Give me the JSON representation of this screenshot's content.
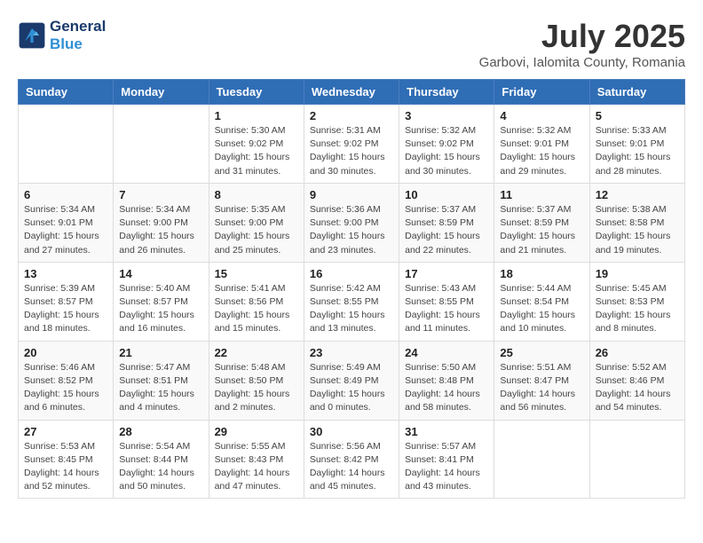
{
  "header": {
    "logo_line1": "General",
    "logo_line2": "Blue",
    "month": "July 2025",
    "location": "Garbovi, Ialomita County, Romania"
  },
  "weekdays": [
    "Sunday",
    "Monday",
    "Tuesday",
    "Wednesday",
    "Thursday",
    "Friday",
    "Saturday"
  ],
  "weeks": [
    [
      {
        "day": null,
        "info": null
      },
      {
        "day": null,
        "info": null
      },
      {
        "day": "1",
        "info": "Sunrise: 5:30 AM\nSunset: 9:02 PM\nDaylight: 15 hours and 31 minutes."
      },
      {
        "day": "2",
        "info": "Sunrise: 5:31 AM\nSunset: 9:02 PM\nDaylight: 15 hours and 30 minutes."
      },
      {
        "day": "3",
        "info": "Sunrise: 5:32 AM\nSunset: 9:02 PM\nDaylight: 15 hours and 30 minutes."
      },
      {
        "day": "4",
        "info": "Sunrise: 5:32 AM\nSunset: 9:01 PM\nDaylight: 15 hours and 29 minutes."
      },
      {
        "day": "5",
        "info": "Sunrise: 5:33 AM\nSunset: 9:01 PM\nDaylight: 15 hours and 28 minutes."
      }
    ],
    [
      {
        "day": "6",
        "info": "Sunrise: 5:34 AM\nSunset: 9:01 PM\nDaylight: 15 hours and 27 minutes."
      },
      {
        "day": "7",
        "info": "Sunrise: 5:34 AM\nSunset: 9:00 PM\nDaylight: 15 hours and 26 minutes."
      },
      {
        "day": "8",
        "info": "Sunrise: 5:35 AM\nSunset: 9:00 PM\nDaylight: 15 hours and 25 minutes."
      },
      {
        "day": "9",
        "info": "Sunrise: 5:36 AM\nSunset: 9:00 PM\nDaylight: 15 hours and 23 minutes."
      },
      {
        "day": "10",
        "info": "Sunrise: 5:37 AM\nSunset: 8:59 PM\nDaylight: 15 hours and 22 minutes."
      },
      {
        "day": "11",
        "info": "Sunrise: 5:37 AM\nSunset: 8:59 PM\nDaylight: 15 hours and 21 minutes."
      },
      {
        "day": "12",
        "info": "Sunrise: 5:38 AM\nSunset: 8:58 PM\nDaylight: 15 hours and 19 minutes."
      }
    ],
    [
      {
        "day": "13",
        "info": "Sunrise: 5:39 AM\nSunset: 8:57 PM\nDaylight: 15 hours and 18 minutes."
      },
      {
        "day": "14",
        "info": "Sunrise: 5:40 AM\nSunset: 8:57 PM\nDaylight: 15 hours and 16 minutes."
      },
      {
        "day": "15",
        "info": "Sunrise: 5:41 AM\nSunset: 8:56 PM\nDaylight: 15 hours and 15 minutes."
      },
      {
        "day": "16",
        "info": "Sunrise: 5:42 AM\nSunset: 8:55 PM\nDaylight: 15 hours and 13 minutes."
      },
      {
        "day": "17",
        "info": "Sunrise: 5:43 AM\nSunset: 8:55 PM\nDaylight: 15 hours and 11 minutes."
      },
      {
        "day": "18",
        "info": "Sunrise: 5:44 AM\nSunset: 8:54 PM\nDaylight: 15 hours and 10 minutes."
      },
      {
        "day": "19",
        "info": "Sunrise: 5:45 AM\nSunset: 8:53 PM\nDaylight: 15 hours and 8 minutes."
      }
    ],
    [
      {
        "day": "20",
        "info": "Sunrise: 5:46 AM\nSunset: 8:52 PM\nDaylight: 15 hours and 6 minutes."
      },
      {
        "day": "21",
        "info": "Sunrise: 5:47 AM\nSunset: 8:51 PM\nDaylight: 15 hours and 4 minutes."
      },
      {
        "day": "22",
        "info": "Sunrise: 5:48 AM\nSunset: 8:50 PM\nDaylight: 15 hours and 2 minutes."
      },
      {
        "day": "23",
        "info": "Sunrise: 5:49 AM\nSunset: 8:49 PM\nDaylight: 15 hours and 0 minutes."
      },
      {
        "day": "24",
        "info": "Sunrise: 5:50 AM\nSunset: 8:48 PM\nDaylight: 14 hours and 58 minutes."
      },
      {
        "day": "25",
        "info": "Sunrise: 5:51 AM\nSunset: 8:47 PM\nDaylight: 14 hours and 56 minutes."
      },
      {
        "day": "26",
        "info": "Sunrise: 5:52 AM\nSunset: 8:46 PM\nDaylight: 14 hours and 54 minutes."
      }
    ],
    [
      {
        "day": "27",
        "info": "Sunrise: 5:53 AM\nSunset: 8:45 PM\nDaylight: 14 hours and 52 minutes."
      },
      {
        "day": "28",
        "info": "Sunrise: 5:54 AM\nSunset: 8:44 PM\nDaylight: 14 hours and 50 minutes."
      },
      {
        "day": "29",
        "info": "Sunrise: 5:55 AM\nSunset: 8:43 PM\nDaylight: 14 hours and 47 minutes."
      },
      {
        "day": "30",
        "info": "Sunrise: 5:56 AM\nSunset: 8:42 PM\nDaylight: 14 hours and 45 minutes."
      },
      {
        "day": "31",
        "info": "Sunrise: 5:57 AM\nSunset: 8:41 PM\nDaylight: 14 hours and 43 minutes."
      },
      {
        "day": null,
        "info": null
      },
      {
        "day": null,
        "info": null
      }
    ]
  ]
}
